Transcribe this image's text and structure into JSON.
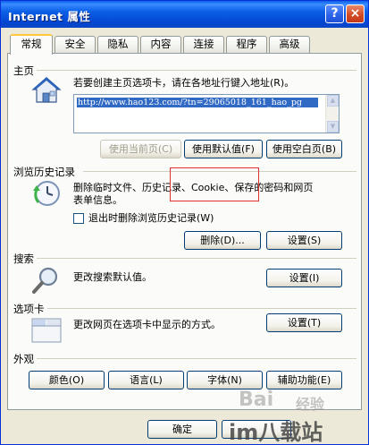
{
  "window": {
    "title": "Internet 属性",
    "help_label": "?",
    "close_label": "×"
  },
  "tabs": [
    "常规",
    "安全",
    "隐私",
    "内容",
    "连接",
    "程序",
    "高级"
  ],
  "home": {
    "title": "主页",
    "desc": "若要创建主页选项卡，请在各地址行键入地址(R)。",
    "url": "http://www.hao123.com/?tn=29065018_161_hao_pg",
    "btn_current": "使用当前页(C)",
    "btn_default": "使用默认值(F)",
    "btn_blank": "使用空白页(B)"
  },
  "history": {
    "title": "浏览历史记录",
    "desc1": "删除临时文件、历史记录、Cookie、保存的密码和网页",
    "desc2": "表单信息。",
    "checkbox_label": "退出时删除浏览历史记录(W)",
    "btn_delete": "删除(D)...",
    "btn_settings": "设置(S)"
  },
  "search": {
    "title": "搜索",
    "desc": "更改搜索默认值。",
    "btn_settings": "设置(I)"
  },
  "tabs_section": {
    "title": "选项卡",
    "desc": "更改网页在选项卡中显示的方式。",
    "btn_settings": "设置(T)"
  },
  "appearance": {
    "title": "外观",
    "btn_colors": "颜色(O)",
    "btn_languages": "语言(L)",
    "btn_fonts": "字体(N)",
    "btn_accessibility": "辅助功能(E)"
  },
  "footer": {
    "btn_ok": "确定"
  },
  "watermark": {
    "baidu": "Bai",
    "jingyan": "经验",
    "site": "im八载站"
  }
}
